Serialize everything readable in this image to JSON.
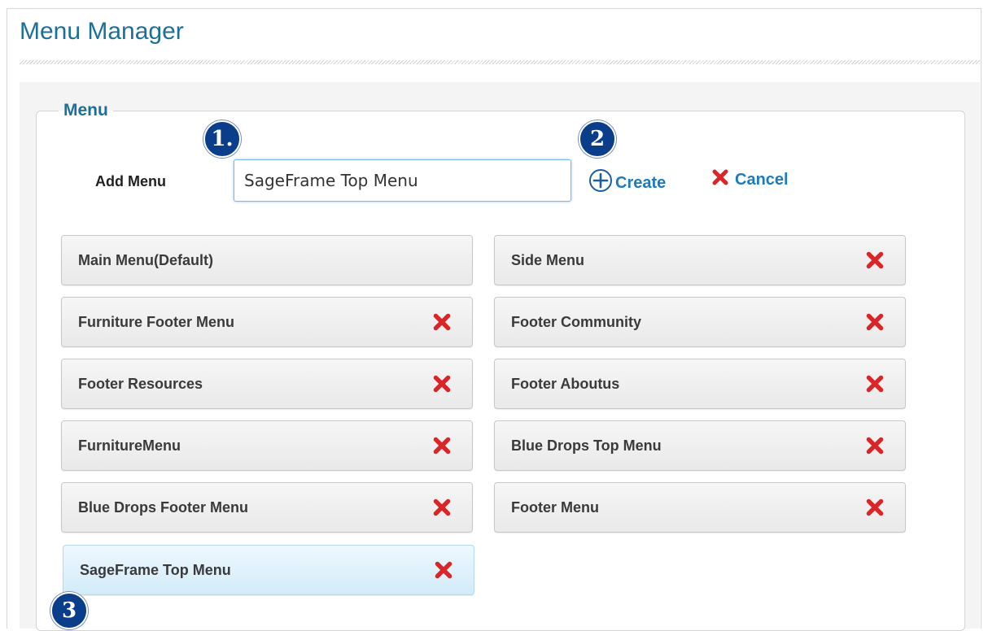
{
  "page": {
    "title": "Menu Manager"
  },
  "menu_section": {
    "legend": "Menu"
  },
  "add_menu": {
    "label": "Add Menu",
    "input_value": "SageFrame Top Menu",
    "create_label": "Create",
    "cancel_label": "Cancel"
  },
  "badges": [
    "1.",
    "2",
    "3"
  ],
  "menu_items": [
    {
      "label": "Main Menu(Default)",
      "deletable": false,
      "active": false
    },
    {
      "label": "Side Menu",
      "deletable": true,
      "active": false
    },
    {
      "label": "Furniture Footer Menu",
      "deletable": true,
      "active": false
    },
    {
      "label": "Footer Community",
      "deletable": true,
      "active": false
    },
    {
      "label": "Footer Resources",
      "deletable": true,
      "active": false
    },
    {
      "label": "Footer Aboutus",
      "deletable": true,
      "active": false
    },
    {
      "label": "FurnitureMenu",
      "deletable": true,
      "active": false
    },
    {
      "label": "Blue Drops Top Menu",
      "deletable": true,
      "active": false
    },
    {
      "label": "Blue Drops Footer Menu",
      "deletable": true,
      "active": false
    },
    {
      "label": "Footer Menu",
      "deletable": true,
      "active": false
    },
    {
      "label": "SageFrame Top Menu",
      "deletable": true,
      "active": true
    }
  ],
  "icons": {
    "create": "plus-circle-icon",
    "cancel": "red-x-icon",
    "delete": "red-x-icon"
  },
  "colors": {
    "heading": "#1d6f98",
    "link": "#1d7bbd",
    "badge": "#0b3e8a",
    "delete": "#d8262a",
    "active_item": "#d2ebf9"
  }
}
